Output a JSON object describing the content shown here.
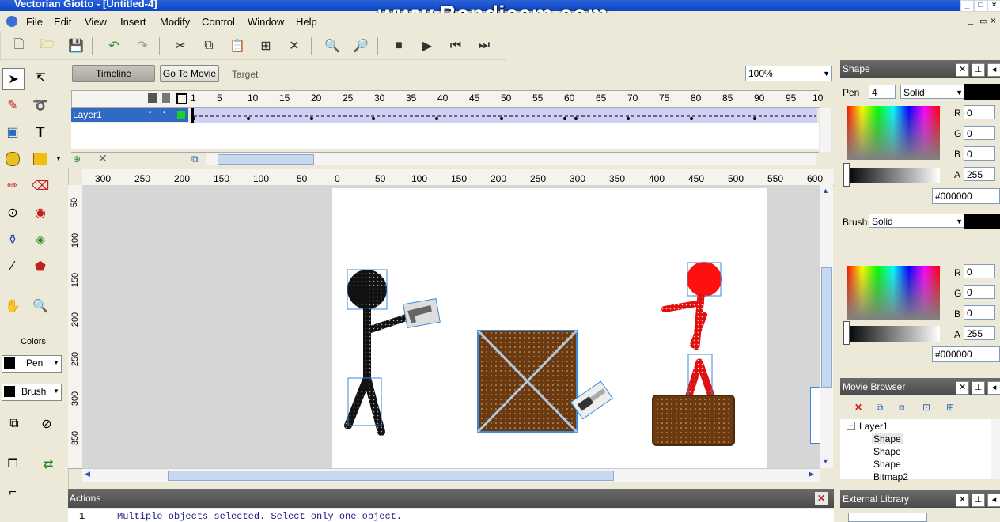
{
  "window": {
    "title": "Vectorian Giotto - [Untitled-4]",
    "watermark": "www.Bandicam.com"
  },
  "menu": [
    "File",
    "Edit",
    "View",
    "Insert",
    "Modify",
    "Control",
    "Window",
    "Help"
  ],
  "timeline": {
    "tab_timeline": "Timeline",
    "goto_movie": "Go To Movie",
    "target_label": "Target",
    "zoom": "100%",
    "frame_numbers": [
      "1",
      "5",
      "10",
      "15",
      "20",
      "25",
      "30",
      "35",
      "40",
      "45",
      "50",
      "55",
      "60",
      "65",
      "70",
      "75",
      "80",
      "85",
      "90",
      "95",
      "10"
    ],
    "layer_name": "Layer1"
  },
  "rulers": {
    "horizontal": [
      "300",
      "250",
      "200",
      "150",
      "100",
      "50",
      "0",
      "50",
      "100",
      "150",
      "200",
      "250",
      "300",
      "350",
      "400",
      "450",
      "500",
      "550",
      "600"
    ],
    "vertical": [
      "50",
      "100",
      "150",
      "200",
      "250",
      "300",
      "350"
    ]
  },
  "colors": {
    "title": "Colors",
    "pen": "Pen",
    "brush": "Brush"
  },
  "shape_panel": {
    "title": "Shape",
    "pen_label": "Pen",
    "pen_width": "4",
    "pen_style": "Solid",
    "r_label": "R",
    "g_label": "G",
    "b_label": "B",
    "a_label": "A",
    "pen_r": "0",
    "pen_g": "0",
    "pen_b": "0",
    "pen_a": "255",
    "pen_hex": "#000000",
    "brush_label": "Brush",
    "brush_style": "Solid",
    "brush_r": "0",
    "brush_g": "0",
    "brush_b": "0",
    "brush_a": "255",
    "brush_hex": "#000000"
  },
  "movie_browser": {
    "title": "Movie Browser",
    "tree": {
      "layer": "Layer1",
      "items": [
        "Shape",
        "Shape",
        "Shape",
        "Bitmap2"
      ]
    }
  },
  "external_library": {
    "title": "External Library"
  },
  "actions": {
    "title": "Actions",
    "line_no": "1",
    "message": "Multiple objects selected. Select only one object."
  }
}
